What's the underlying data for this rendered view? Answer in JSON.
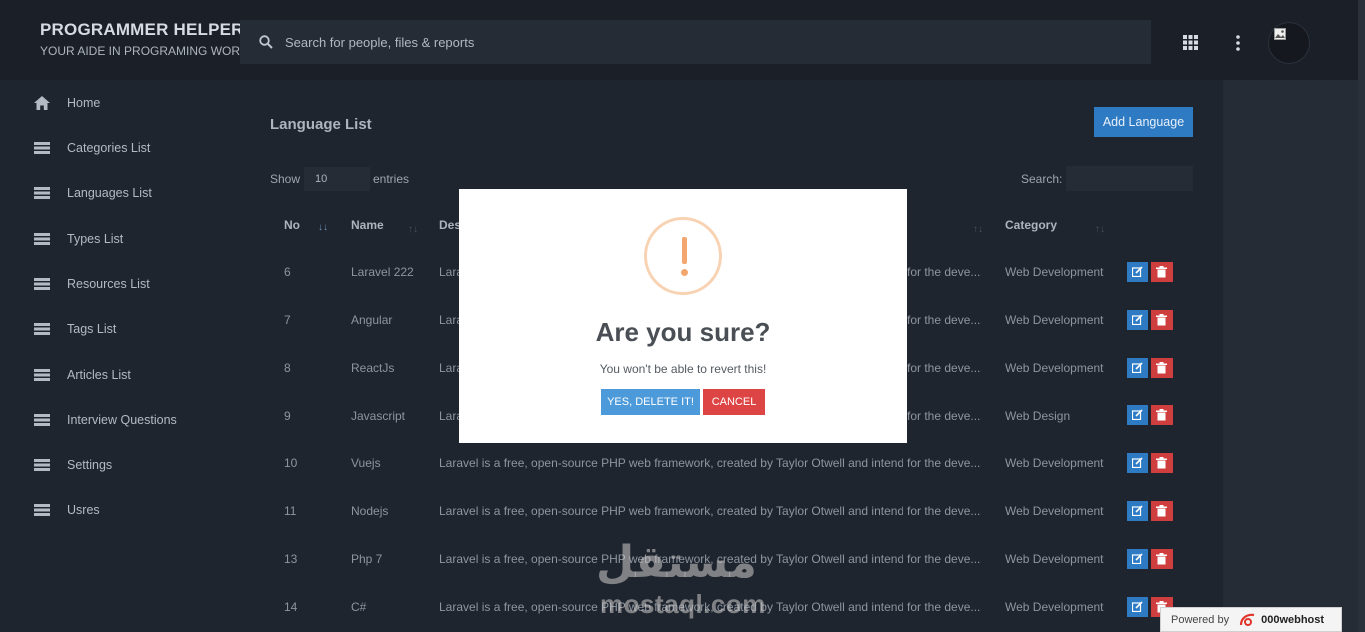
{
  "brand": {
    "title": "PROGRAMMER HELPER",
    "subtitle": "YOUR AIDE IN PROGRAMING WORLD"
  },
  "search": {
    "placeholder": "Search for people, files & reports"
  },
  "header_icons": [
    "search-icon",
    "apps-grid-icon",
    "more-vertical-icon",
    "avatar-image-icon"
  ],
  "sidebar": {
    "items": [
      {
        "label": "Home",
        "icon": "home-icon"
      },
      {
        "label": "Categories List",
        "icon": "list-icon"
      },
      {
        "label": "Languages List",
        "icon": "list-icon"
      },
      {
        "label": "Types List",
        "icon": "list-icon"
      },
      {
        "label": "Resources List",
        "icon": "list-icon"
      },
      {
        "label": "Tags List",
        "icon": "list-icon"
      },
      {
        "label": "Articles List",
        "icon": "list-icon"
      },
      {
        "label": "Interview Questions",
        "icon": "list-icon"
      },
      {
        "label": "Settings",
        "icon": "list-icon"
      },
      {
        "label": "Usres",
        "icon": "list-icon"
      }
    ]
  },
  "main": {
    "title": "Language List",
    "add_button": "Add Language",
    "show_label": "Show",
    "entries_value": "10",
    "entries_label": "entries",
    "search_label": "Search:",
    "columns": [
      "No",
      "Name",
      "Des",
      "Category"
    ],
    "rows": [
      {
        "no": "6",
        "name": "Laravel 222",
        "desc_left": "Lara",
        "desc_right": "for the deve...",
        "category": "Web Development"
      },
      {
        "no": "7",
        "name": "Angular",
        "desc_left": "Lara",
        "desc_right": "for the deve...",
        "category": "Web Development"
      },
      {
        "no": "8",
        "name": "ReactJs",
        "desc_left": "Lara",
        "desc_right": "for the deve...",
        "category": "Web Development"
      },
      {
        "no": "9",
        "name": "Javascript",
        "desc_left": "Lara",
        "desc_right": "for the deve...",
        "category": "Web Design"
      },
      {
        "no": "10",
        "name": "Vuejs",
        "desc_left": "Laravel is a free, open-source PHP web framework, created by Taylor Otwell and intended",
        "desc_right": "for the deve...",
        "category": "Web Development"
      },
      {
        "no": "11",
        "name": "Nodejs",
        "desc_left": "Laravel is a free, open-source PHP web framework, created by Taylor Otwell and intended",
        "desc_right": "for the deve...",
        "category": "Web Development"
      },
      {
        "no": "13",
        "name": "Php 7",
        "desc_left": "Laravel is a free, open-source PHP web framework, created by Taylor Otwell and intended",
        "desc_right": "for the deve...",
        "category": "Web Development"
      },
      {
        "no": "14",
        "name": "C#",
        "desc_left": "Laravel is a free, open-source PHP web framework, created by Taylor Otwell and intended",
        "desc_right": "for the deve...",
        "category": "Web Development"
      }
    ],
    "row_actions": {
      "edit_icon": "edit-icon",
      "delete_icon": "trash-icon"
    }
  },
  "modal": {
    "icon": "warning-icon",
    "title": "Are you sure?",
    "text": "You won't be able to revert this!",
    "confirm": "YES, DELETE IT!",
    "cancel": "CANCEL",
    "warning_color": "#f3a66e"
  },
  "watermark": {
    "arabic": "مستقل",
    "latin": "mostaql.com"
  },
  "badge": {
    "prefix": "Powered by",
    "brand": "000webhost"
  },
  "colors": {
    "primary": "#2e7bc4",
    "danger": "#cf3e3e",
    "background": "#252c36"
  }
}
